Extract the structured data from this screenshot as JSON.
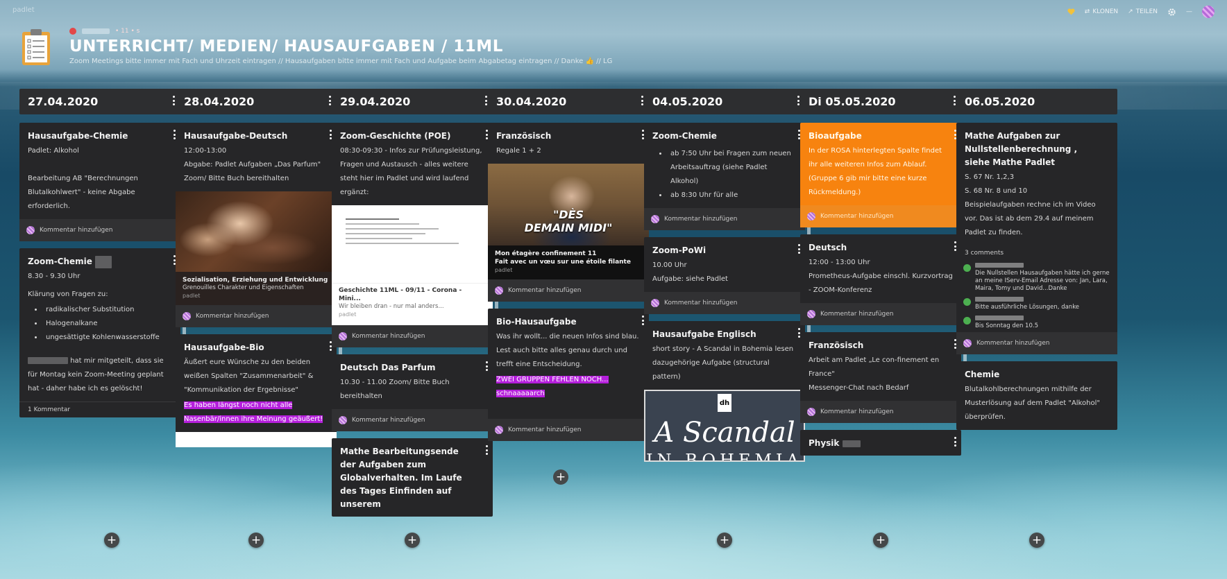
{
  "app": {
    "brand": "padlet"
  },
  "toolbar": {
    "clone_label": "KLONEN",
    "share_label": "TEILEN"
  },
  "board": {
    "title": "UNTERRICHT/ MEDIEN/ HAUSAUFGABEN / 11ML",
    "subtitle": "Zoom Meetings bitte immer mit Fach und Uhrzeit eintragen // Hausaufgaben bitte immer mit Fach und Aufgabe beim Abgabetag eintragen // Danke 👍 // LG",
    "meta": "• 11 • s"
  },
  "comment_prompt": "Kommentar hinzufügen",
  "columns": [
    {
      "date": "27.04.2020",
      "cards": [
        {
          "title": "Hausaufgabe-Chemie",
          "text": "Padlet: Alkohol\n\nBearbeitung AB \"Berechnungen Blutalkohlwert\" - keine Abgabe erforderlich."
        },
        {
          "title": "Zoom-Chemie",
          "text": "8.30 - 9.30 Uhr",
          "list_intro": "Klärung von Fragen zu:",
          "list": [
            "radikalischer Substitution",
            "Halogenalkane",
            "ungesättigte Kohlenwasserstoffe"
          ],
          "after": "hat mir mitgeteilt, dass sie für Montag kein Zoom-Meeting geplant hat - daher habe ich es gelöscht!",
          "comments": "1 Kommentar"
        }
      ]
    },
    {
      "date": "28.04.2020",
      "cards": [
        {
          "title": "Hausaufgabe-Deutsch",
          "text": "12:00-13:00\nAbgabe: Padlet Aufgaben „Das Parfum\"\nZoom/ Bitte Buch bereithalten",
          "att_title": "Sozialisation, Erziehung und Entwicklung",
          "att_desc": "Grenouilles Charakter und Eigenschaften",
          "att_source": "padlet"
        },
        {
          "title": "Hausaufgabe-Bio",
          "text": "Äußert eure Wünsche zu den beiden weißen Spalten \"Zusammenarbeit\" & \"Kommunikation der Ergebnisse\"",
          "highlight": "Es haben längst noch nicht alle Nasenbär/innen ihre Meinung geäußert!"
        }
      ]
    },
    {
      "date": "29.04.2020",
      "cards": [
        {
          "title": "Zoom-Geschichte (POE)",
          "text": "08:30-09:30 - Infos zur Prüfungsleistung, Fragen und Austausch - alles weitere steht hier im Padlet und wird laufend ergänzt:",
          "att_title": "Geschichte 11ML - 09/11 - Corona - Mini...",
          "att_desc": "Wir bleiben dran - nur mal anders...",
          "att_source": "padlet"
        },
        {
          "title": "Deutsch Das Parfum",
          "text": "10.30 - 11.00 Zoom/ Bitte Buch bereithalten"
        },
        {
          "title": "Mathe Bearbeitungsende der Aufgaben zum Globalverhalten. Im Laufe des Tages Einfinden auf unserem"
        }
      ]
    },
    {
      "date": "30.04.2020",
      "cards": [
        {
          "title": "Französisch",
          "text": "Regale 1 + 2",
          "video_text": "\"DÈS\nDEMAIN MIDI\"",
          "att_title": "Mon étagère confinement 11\nFait avec un vœu sur une étoile filante",
          "att_source": "padlet"
        },
        {
          "title": "Bio-Hausaufgabe",
          "text": "Was ihr wollt... die neuen Infos sind blau. Lest auch bitte alles genau durch und trefft eine Entscheidung.",
          "highlight": "ZWEI GRUPPEN FEHLEN NOCH... schnaaaaarch"
        }
      ]
    },
    {
      "date": "04.05.2020",
      "cards": [
        {
          "title": "Zoom-Chemie",
          "list": [
            "ab 7:50 Uhr bei Fragen zum neuen Arbeitsauftrag (siehe Padlet Alkohol)",
            "ab 8:30 Uhr für alle"
          ]
        },
        {
          "title": "Zoom-PoWi",
          "text": "10.00 Uhr\nAufgabe: siehe Padlet"
        },
        {
          "title": "Hausaufgabe Englisch",
          "text": "short story - A Scandal in Bohemia lesen\ndazugehörige Aufgabe (structural pattern)",
          "book_title": "A Scandal",
          "book_sub": "IN BOHEMIA",
          "book_logo": "dh"
        }
      ]
    },
    {
      "date": "Di 05.05.2020",
      "cards": [
        {
          "title": "Bioaufgabe",
          "text": "In der ROSA hinterlegten Spalte findet ihr alle weiteren Infos zum Ablauf.\n(Gruppe 6 gib mir bitte eine kurze Rückmeldung.)"
        },
        {
          "title": "Deutsch",
          "text": "12:00 - 13:00 Uhr\nPrometheus-Aufgabe einschl. Kurzvortrag - ZOOM-Konferenz"
        },
        {
          "title": "Französisch",
          "text": "Arbeit am Padlet „Le con-finement en France\"\nMessenger-Chat nach Bedarf"
        },
        {
          "title": "Physik"
        }
      ]
    },
    {
      "date": "06.05.2020",
      "cards": [
        {
          "title": "Mathe Aufgaben zur Nullstellenberechnung , siehe Mathe Padlet",
          "text": "S. 67 Nr. 1,2,3\nS. 68 Nr. 8 und 10\nBeispielaufgaben rechne ich im Video vor. Das ist ab dem 29.4 auf meinem Padlet zu finden.",
          "comments": "3 comments",
          "comment_list": [
            "Die Nullstellen Hausaufgaben hätte ich gerne an meine IServ-Email Adresse von: Jan, Lara, Maira, Tomy und David...Danke",
            "Bitte ausführliche Lösungen, danke",
            "Bis Sonntag den 10.5"
          ]
        },
        {
          "title": "Chemie",
          "text": "Blutalkohlberechnungen mithilfe der Musterlösung auf dem Padlet \"Alkohol\" überprüfen."
        }
      ]
    }
  ],
  "colors": {
    "card": "#262628",
    "orange": "#f7830f",
    "highlight": "#b51fdc",
    "header": "#2d2e30"
  }
}
